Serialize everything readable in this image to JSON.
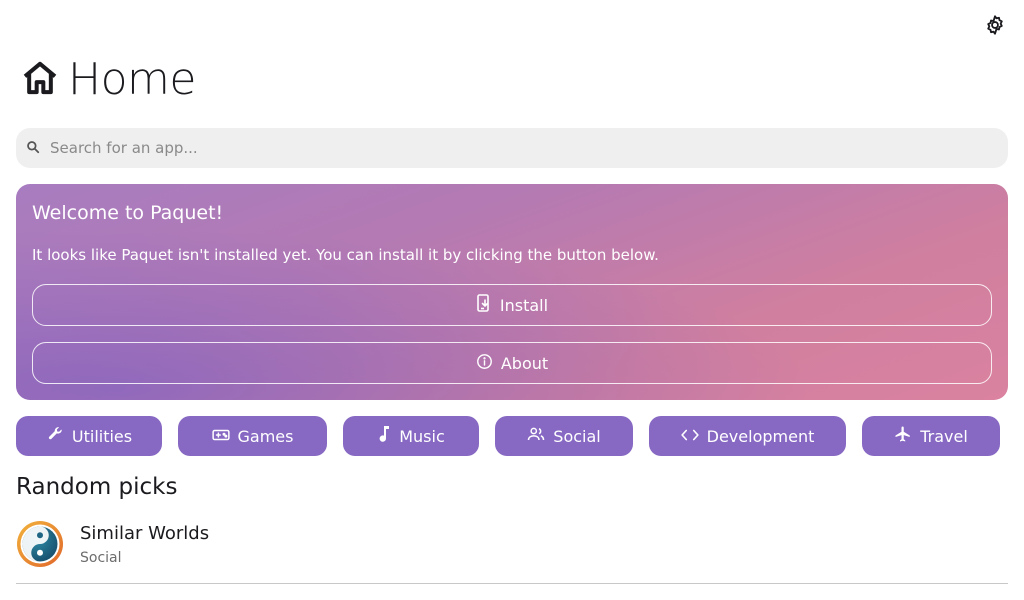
{
  "header": {
    "title": "Home",
    "home_icon": "home-icon",
    "settings_icon": "gear-icon"
  },
  "search": {
    "placeholder": "Search for an app...",
    "value": "",
    "icon": "search-icon"
  },
  "welcome_card": {
    "title": "Welcome to Paquet!",
    "message": "It looks like Paquet isn't installed yet. You can install it by clicking the button below.",
    "install_label": "Install",
    "install_icon": "install-phone-icon",
    "about_label": "About",
    "about_icon": "info-icon"
  },
  "categories": [
    {
      "label": "Utilities",
      "icon": "wrench-icon"
    },
    {
      "label": "Games",
      "icon": "gamepad-icon"
    },
    {
      "label": "Music",
      "icon": "music-note-icon"
    },
    {
      "label": "Social",
      "icon": "people-icon"
    },
    {
      "label": "Development",
      "icon": "code-icon"
    },
    {
      "label": "Travel",
      "icon": "airplane-icon"
    }
  ],
  "random_picks": {
    "title": "Random picks",
    "items": [
      {
        "name": "Similar Worlds",
        "category": "Social",
        "icon": "similar-worlds-logo"
      }
    ]
  },
  "colors": {
    "chip_background": "#8768c3",
    "search_background": "#efefef",
    "card_gradient_start": "#a77cc0",
    "card_gradient_end": "#da82a0"
  }
}
